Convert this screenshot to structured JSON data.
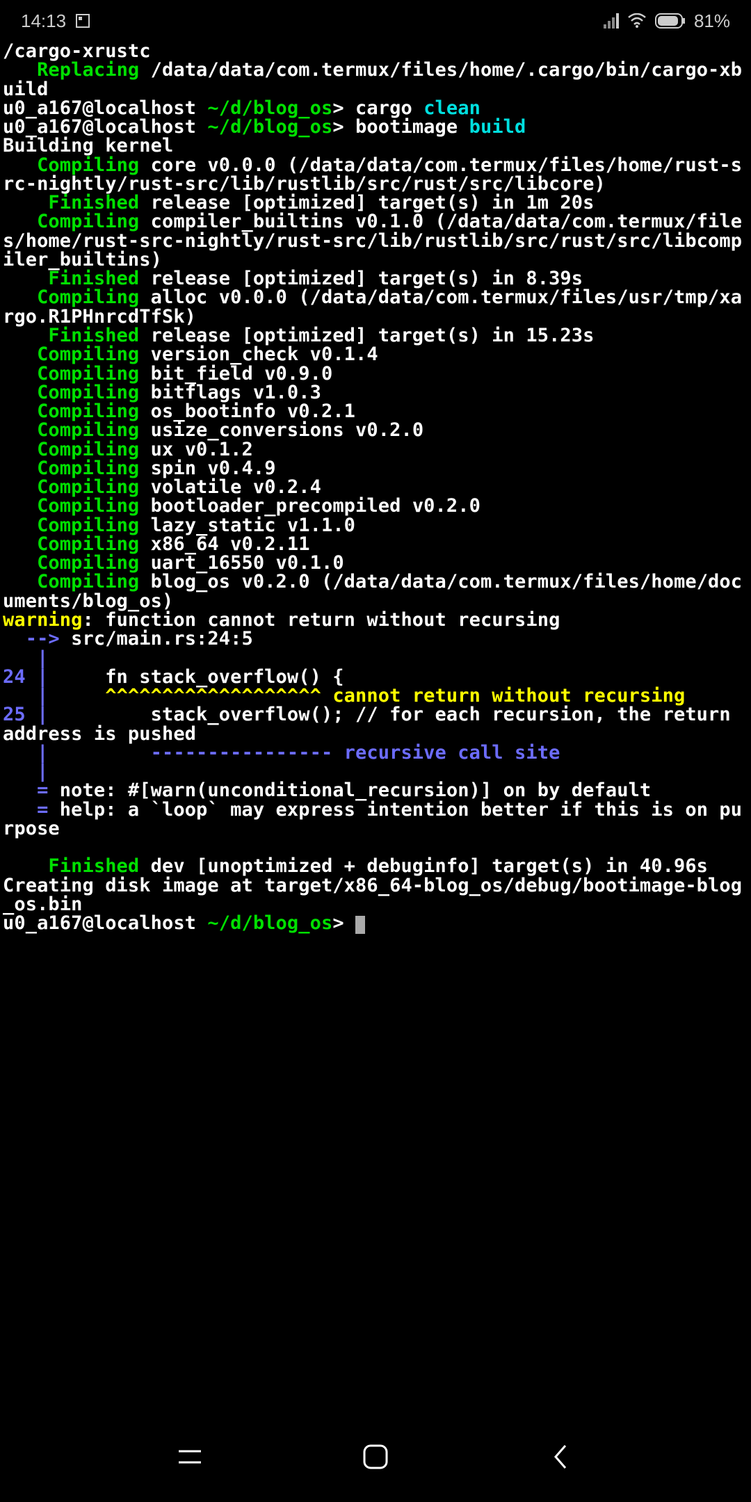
{
  "status": {
    "time": "14:13",
    "battery": "81%"
  },
  "lines": [
    [
      [
        "w",
        "/cargo-xrustc"
      ]
    ],
    [
      [
        "g",
        "   Replacing "
      ],
      [
        "w",
        "/data/data/com.termux/files/home/.cargo/bin/cargo-xbuild"
      ]
    ],
    [
      [
        "w",
        "u0_a167@localhost "
      ],
      [
        "g",
        "~/d/blog_os"
      ],
      [
        "w",
        "> "
      ],
      [
        "w",
        "cargo "
      ],
      [
        "c",
        "clean"
      ]
    ],
    [
      [
        "w",
        "u0_a167@localhost "
      ],
      [
        "g",
        "~/d/blog_os"
      ],
      [
        "w",
        "> "
      ],
      [
        "w",
        "bootimage "
      ],
      [
        "c",
        "build"
      ]
    ],
    [
      [
        "w",
        "Building kernel"
      ]
    ],
    [
      [
        "g",
        "   Compiling "
      ],
      [
        "w",
        "core v0.0.0 (/data/data/com.termux/files/home/rust-src-nightly/rust-src/lib/rustlib/src/rust/src/libcore)"
      ]
    ],
    [
      [
        "g",
        "    Finished "
      ],
      [
        "w",
        "release [optimized] target(s) in 1m 20s"
      ]
    ],
    [
      [
        "g",
        "   Compiling "
      ],
      [
        "w",
        "compiler_builtins v0.1.0 (/data/data/com.termux/files/home/rust-src-nightly/rust-src/lib/rustlib/src/rust/src/libcompiler_builtins)"
      ]
    ],
    [
      [
        "g",
        "    Finished "
      ],
      [
        "w",
        "release [optimized] target(s) in 8.39s"
      ]
    ],
    [
      [
        "g",
        "   Compiling "
      ],
      [
        "w",
        "alloc v0.0.0 (/data/data/com.termux/files/usr/tmp/xargo.R1PHnrcdTfSk)"
      ]
    ],
    [
      [
        "g",
        "    Finished "
      ],
      [
        "w",
        "release [optimized] target(s) in 15.23s"
      ]
    ],
    [
      [
        "g",
        "   Compiling "
      ],
      [
        "w",
        "version_check v0.1.4"
      ]
    ],
    [
      [
        "g",
        "   Compiling "
      ],
      [
        "w",
        "bit_field v0.9.0"
      ]
    ],
    [
      [
        "g",
        "   Compiling "
      ],
      [
        "w",
        "bitflags v1.0.3"
      ]
    ],
    [
      [
        "g",
        "   Compiling "
      ],
      [
        "w",
        "os_bootinfo v0.2.1"
      ]
    ],
    [
      [
        "g",
        "   Compiling "
      ],
      [
        "w",
        "usize_conversions v0.2.0"
      ]
    ],
    [
      [
        "g",
        "   Compiling "
      ],
      [
        "w",
        "ux v0.1.2"
      ]
    ],
    [
      [
        "g",
        "   Compiling "
      ],
      [
        "w",
        "spin v0.4.9"
      ]
    ],
    [
      [
        "g",
        "   Compiling "
      ],
      [
        "w",
        "volatile v0.2.4"
      ]
    ],
    [
      [
        "g",
        "   Compiling "
      ],
      [
        "w",
        "bootloader_precompiled v0.2.0"
      ]
    ],
    [
      [
        "g",
        "   Compiling "
      ],
      [
        "w",
        "lazy_static v1.1.0"
      ]
    ],
    [
      [
        "g",
        "   Compiling "
      ],
      [
        "w",
        "x86_64 v0.2.11"
      ]
    ],
    [
      [
        "g",
        "   Compiling "
      ],
      [
        "w",
        "uart_16550 v0.1.0"
      ]
    ],
    [
      [
        "g",
        "   Compiling "
      ],
      [
        "w",
        "blog_os v0.2.0 (/data/data/com.termux/files/home/documents/blog_os)"
      ]
    ],
    [
      [
        "y",
        "warning"
      ],
      [
        "w",
        ": function cannot return without recursing"
      ]
    ],
    [
      [
        "b",
        "  --> "
      ],
      [
        "w",
        "src/main.rs:24:5"
      ]
    ],
    [
      [
        "b",
        "   |"
      ]
    ],
    [
      [
        "b",
        "24 |"
      ],
      [
        "w",
        "     fn stack_overflow() {"
      ]
    ],
    [
      [
        "b",
        "   |"
      ],
      [
        "y",
        "     ^^^^^^^^^^^^^^^^^^^ cannot return without recursing"
      ]
    ],
    [
      [
        "b",
        "25 |"
      ],
      [
        "w",
        "         stack_overflow(); // for each recursion, the return address is pushed"
      ]
    ],
    [
      [
        "b",
        "   |         ---------------- recursive call site"
      ]
    ],
    [
      [
        "b",
        "   |"
      ]
    ],
    [
      [
        "b",
        "   = "
      ],
      [
        "w",
        "note"
      ],
      [
        "w",
        ": #[warn(unconditional_recursion)] on by default"
      ]
    ],
    [
      [
        "b",
        "   = "
      ],
      [
        "w",
        "help"
      ],
      [
        "w",
        ": a `loop` may express intention better if this is on purpose"
      ]
    ],
    [
      [
        "w",
        ""
      ]
    ],
    [
      [
        "g",
        "    Finished "
      ],
      [
        "w",
        "dev [unoptimized + debuginfo] target(s) in 40.96s"
      ]
    ],
    [
      [
        "w",
        "Creating disk image at target/x86_64-blog_os/debug/bootimage-blog_os.bin"
      ]
    ],
    [
      [
        "w",
        "u0_a167@localhost "
      ],
      [
        "g",
        "~/d/blog_os"
      ],
      [
        "w",
        "> "
      ],
      [
        "cursor",
        ""
      ]
    ]
  ]
}
